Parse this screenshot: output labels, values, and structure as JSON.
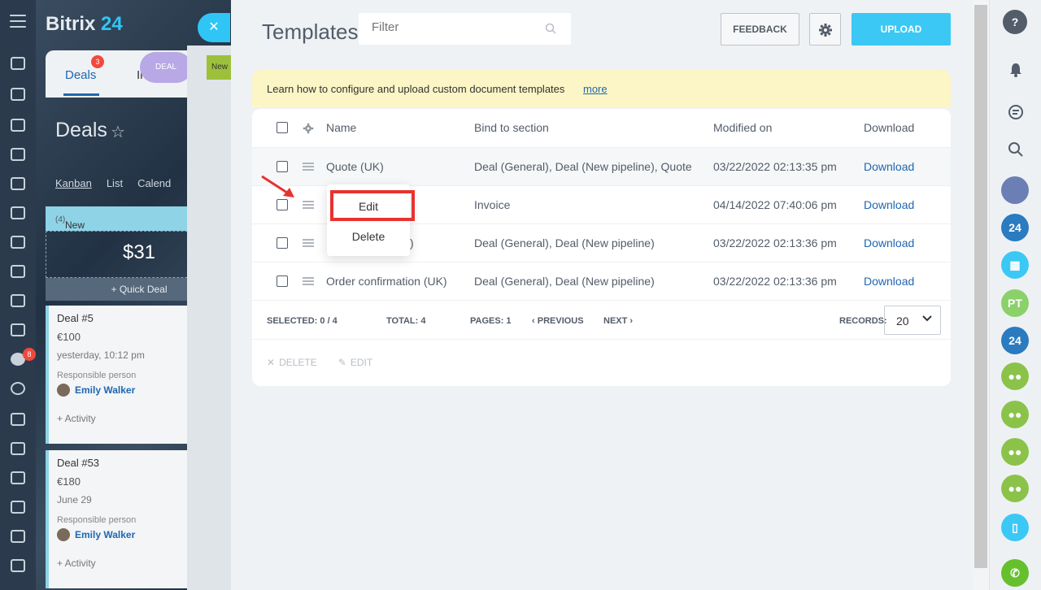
{
  "crm": {
    "logo_prefix": "Bitrix",
    "logo_suffix": "24",
    "tab_deals": "Deals",
    "tab_deals_badge": "3",
    "tab_in": "In",
    "deal_pill": "DEAL",
    "page_title": "Deals",
    "views": [
      "Kanban",
      "List",
      "Calend"
    ],
    "column_label": "New",
    "column_count": "(4)",
    "column_total": "$31",
    "quick_deal": "+ Quick Deal",
    "nav_badge": "8",
    "new_pill": "New",
    "cards": [
      {
        "title": "Deal #5",
        "amount": "€100",
        "date": "yesterday, 10:12 pm",
        "resp_label": "Responsible person",
        "person": "Emily Walker",
        "activity": "+ Activity"
      },
      {
        "title": "Deal #53",
        "amount": "€180",
        "date": "June 29",
        "resp_label": "Responsible person",
        "person": "Emily Walker",
        "activity": "+ Activity"
      }
    ]
  },
  "templates": {
    "title": "Templates",
    "filter_placeholder": "Filter",
    "feedback_label": "FEEDBACK",
    "upload_label": "UPLOAD",
    "notice_text": "Learn how to configure and upload custom document templates",
    "notice_link": "more",
    "columns": {
      "name": "Name",
      "bind": "Bind to section",
      "modified": "Modified on",
      "download": "Download"
    },
    "rows": [
      {
        "name": "Quote (UK)",
        "bind": "Deal (General), Deal (New pipeline), Quote",
        "modified": "03/22/2022 02:13:35 pm",
        "download": "Download"
      },
      {
        "name": "",
        "bind": "Invoice",
        "modified": "04/14/2022 07:40:06 pm",
        "download": "Download"
      },
      {
        "name": ")",
        "bind": "Deal (General), Deal (New pipeline)",
        "modified": "03/22/2022 02:13:36 pm",
        "download": "Download"
      },
      {
        "name": "Order confirmation (UK)",
        "bind": "Deal (General), Deal (New pipeline)",
        "modified": "03/22/2022 02:13:36 pm",
        "download": "Download"
      }
    ],
    "footer": {
      "selected": "SELECTED: 0 / 4",
      "total": "TOTAL: 4",
      "pages": "PAGES:  1",
      "previous": "PREVIOUS",
      "next": "NEXT",
      "records_label": "RECORDS:",
      "records_value": "20"
    },
    "actions": {
      "delete": "DELETE",
      "edit": "EDIT"
    },
    "context_menu": {
      "edit": "Edit",
      "delete": "Delete"
    }
  },
  "rightbar": {
    "help": "?",
    "b24_label": "24",
    "pt_initials": "PT"
  },
  "colors": {
    "accent": "#3bc8f5",
    "link": "#2067b0",
    "highlight": "#e8322f",
    "notice": "#fcf5c6"
  }
}
